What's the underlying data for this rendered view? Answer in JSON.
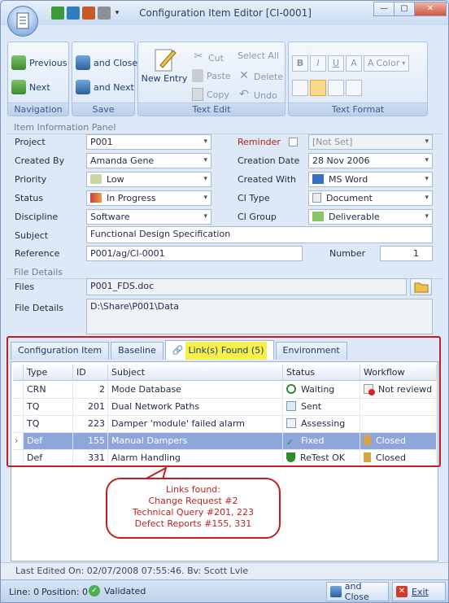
{
  "window": {
    "title": "Configuration Item Editor [CI-0001]"
  },
  "ribbon": {
    "navigation": {
      "label": "Navigation",
      "previous": "Previous",
      "next": "Next"
    },
    "save": {
      "label": "Save",
      "and_close": "and Close",
      "and_next": "and Next"
    },
    "text_edit": {
      "label": "Text Edit",
      "new_entry": "New Entry",
      "cut": "Cut",
      "paste": "Paste",
      "copy": "Copy",
      "select_all": "Select All",
      "delete": "Delete",
      "undo": "Undo"
    },
    "text_format": {
      "label": "Text Format",
      "bold": "B",
      "italic": "I",
      "underline": "U",
      "font": "A",
      "color": "Color"
    }
  },
  "item_panel": {
    "title": "Item Information Panel",
    "project_label": "Project",
    "project_value": "P001",
    "reminder_label": "Reminder",
    "reminder_value": "[Not Set]",
    "created_by_label": "Created By",
    "created_by_value": "Amanda Gene",
    "creation_date_label": "Creation Date",
    "creation_date_value": "28 Nov 2006",
    "priority_label": "Priority",
    "priority_value": "Low",
    "created_with_label": "Created With",
    "created_with_value": "MS Word",
    "status_label": "Status",
    "status_value": "In Progress",
    "ci_type_label": "CI Type",
    "ci_type_value": "Document",
    "discipline_label": "Discipline",
    "discipline_value": "Software",
    "ci_group_label": "CI Group",
    "ci_group_value": "Deliverable",
    "subject_label": "Subject",
    "subject_value": "Functional Design Specification",
    "reference_label": "Reference",
    "reference_value": "P001/ag/CI-0001",
    "number_label": "Number",
    "number_value": "1"
  },
  "file_panel": {
    "title": "File Details",
    "files_label": "Files",
    "files_value": "P001_FDS.doc",
    "details_label": "File Details",
    "details_value": "D:\\Share\\P001\\Data"
  },
  "tabs": [
    "Configuration Item",
    "Baseline",
    "Link(s) Found (5)",
    "Environment"
  ],
  "grid": {
    "headers": [
      "Type",
      "ID",
      "Subject",
      "Status",
      "Workflow"
    ],
    "rows": [
      {
        "type": "CRN",
        "id": "2",
        "subject": "Mode Database",
        "status": "Waiting",
        "workflow": "Not reviewd"
      },
      {
        "type": "TQ",
        "id": "201",
        "subject": "Dual Network Paths",
        "status": "Sent",
        "workflow": ""
      },
      {
        "type": "TQ",
        "id": "223",
        "subject": "Damper 'module' failed alarm",
        "status": "Assessing",
        "workflow": ""
      },
      {
        "type": "Def",
        "id": "155",
        "subject": "Manual Dampers",
        "status": "Fixed",
        "workflow": "Closed"
      },
      {
        "type": "Def",
        "id": "331",
        "subject": "Alarm Handling",
        "status": "ReTest OK",
        "workflow": "Closed"
      }
    ]
  },
  "callout": {
    "line1": "Links found:",
    "line2": "Change Request #2",
    "line3": "Technical Query #201, 223",
    "line4": "Defect Reports #155, 331"
  },
  "footer": {
    "last_edited": "Last Edited On: 02/07/2008 07:55:46. Bv: Scott Lvle"
  },
  "statusbar": {
    "line": "Line: 0",
    "position": "Position: 0",
    "validated": "Validated",
    "and_close": "and Close",
    "exit": "Exit"
  },
  "colors": {
    "accent_red": "#c21f1f",
    "selected_row": "#8fa6dd",
    "highlight_tab": "#f7f04a"
  }
}
